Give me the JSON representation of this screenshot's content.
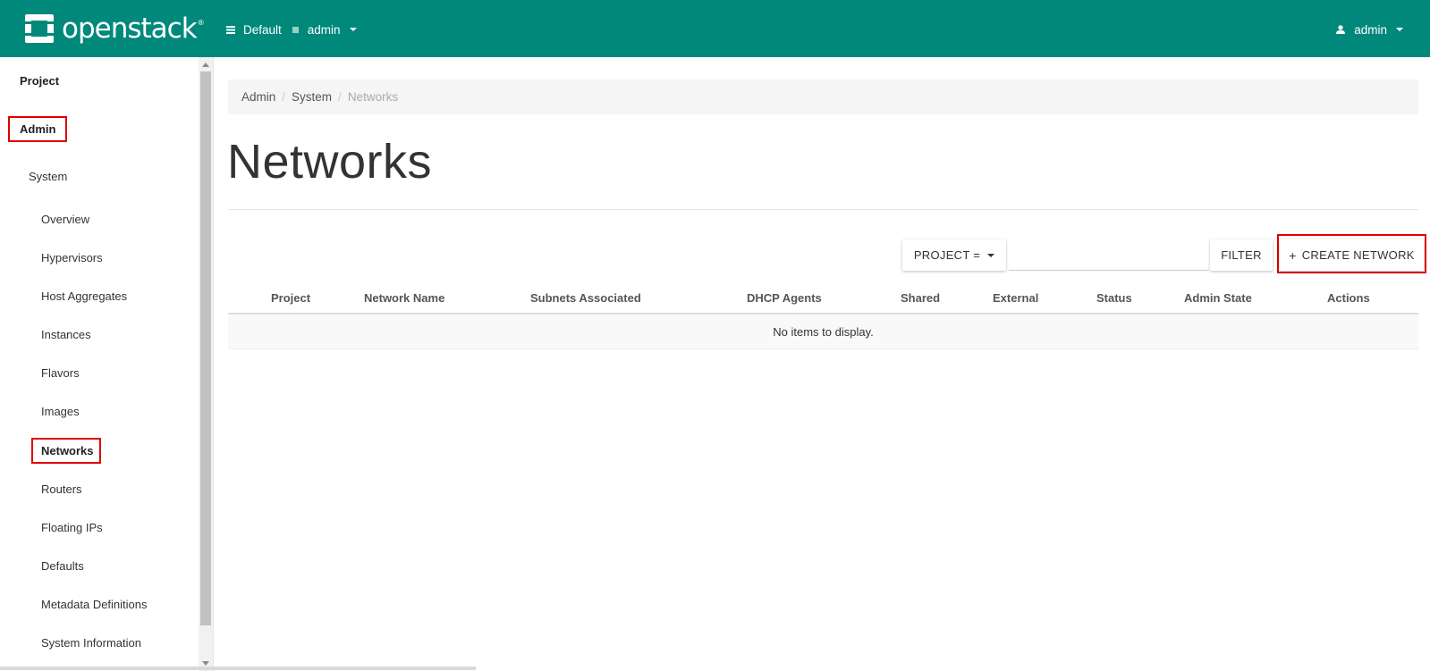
{
  "header": {
    "brand": "openstack",
    "brand_reg": "®",
    "domain": "Default",
    "project": "admin",
    "user": "admin",
    "bar_color": "#00897b"
  },
  "sidebar": {
    "project": "Project",
    "admin": "Admin",
    "system": "System",
    "items": [
      {
        "label": "Overview"
      },
      {
        "label": "Hypervisors"
      },
      {
        "label": "Host Aggregates"
      },
      {
        "label": "Instances"
      },
      {
        "label": "Flavors"
      },
      {
        "label": "Images"
      },
      {
        "label": "Networks"
      },
      {
        "label": "Routers"
      },
      {
        "label": "Floating IPs"
      },
      {
        "label": "Defaults"
      },
      {
        "label": "Metadata Definitions"
      },
      {
        "label": "System Information"
      }
    ],
    "active": "Networks"
  },
  "breadcrumb": {
    "items": [
      "Admin",
      "System",
      "Networks"
    ]
  },
  "page": {
    "title": "Networks"
  },
  "toolbar": {
    "filter_field": "PROJECT =",
    "filter_button": "FILTER",
    "create_button": "CREATE NETWORK",
    "create_icon": "+"
  },
  "table": {
    "columns": [
      "Project",
      "Network Name",
      "Subnets Associated",
      "DHCP Agents",
      "Shared",
      "External",
      "Status",
      "Admin State",
      "Actions"
    ],
    "empty_message": "No items to display."
  },
  "annotations": {
    "highlight_color": "#e00000"
  }
}
